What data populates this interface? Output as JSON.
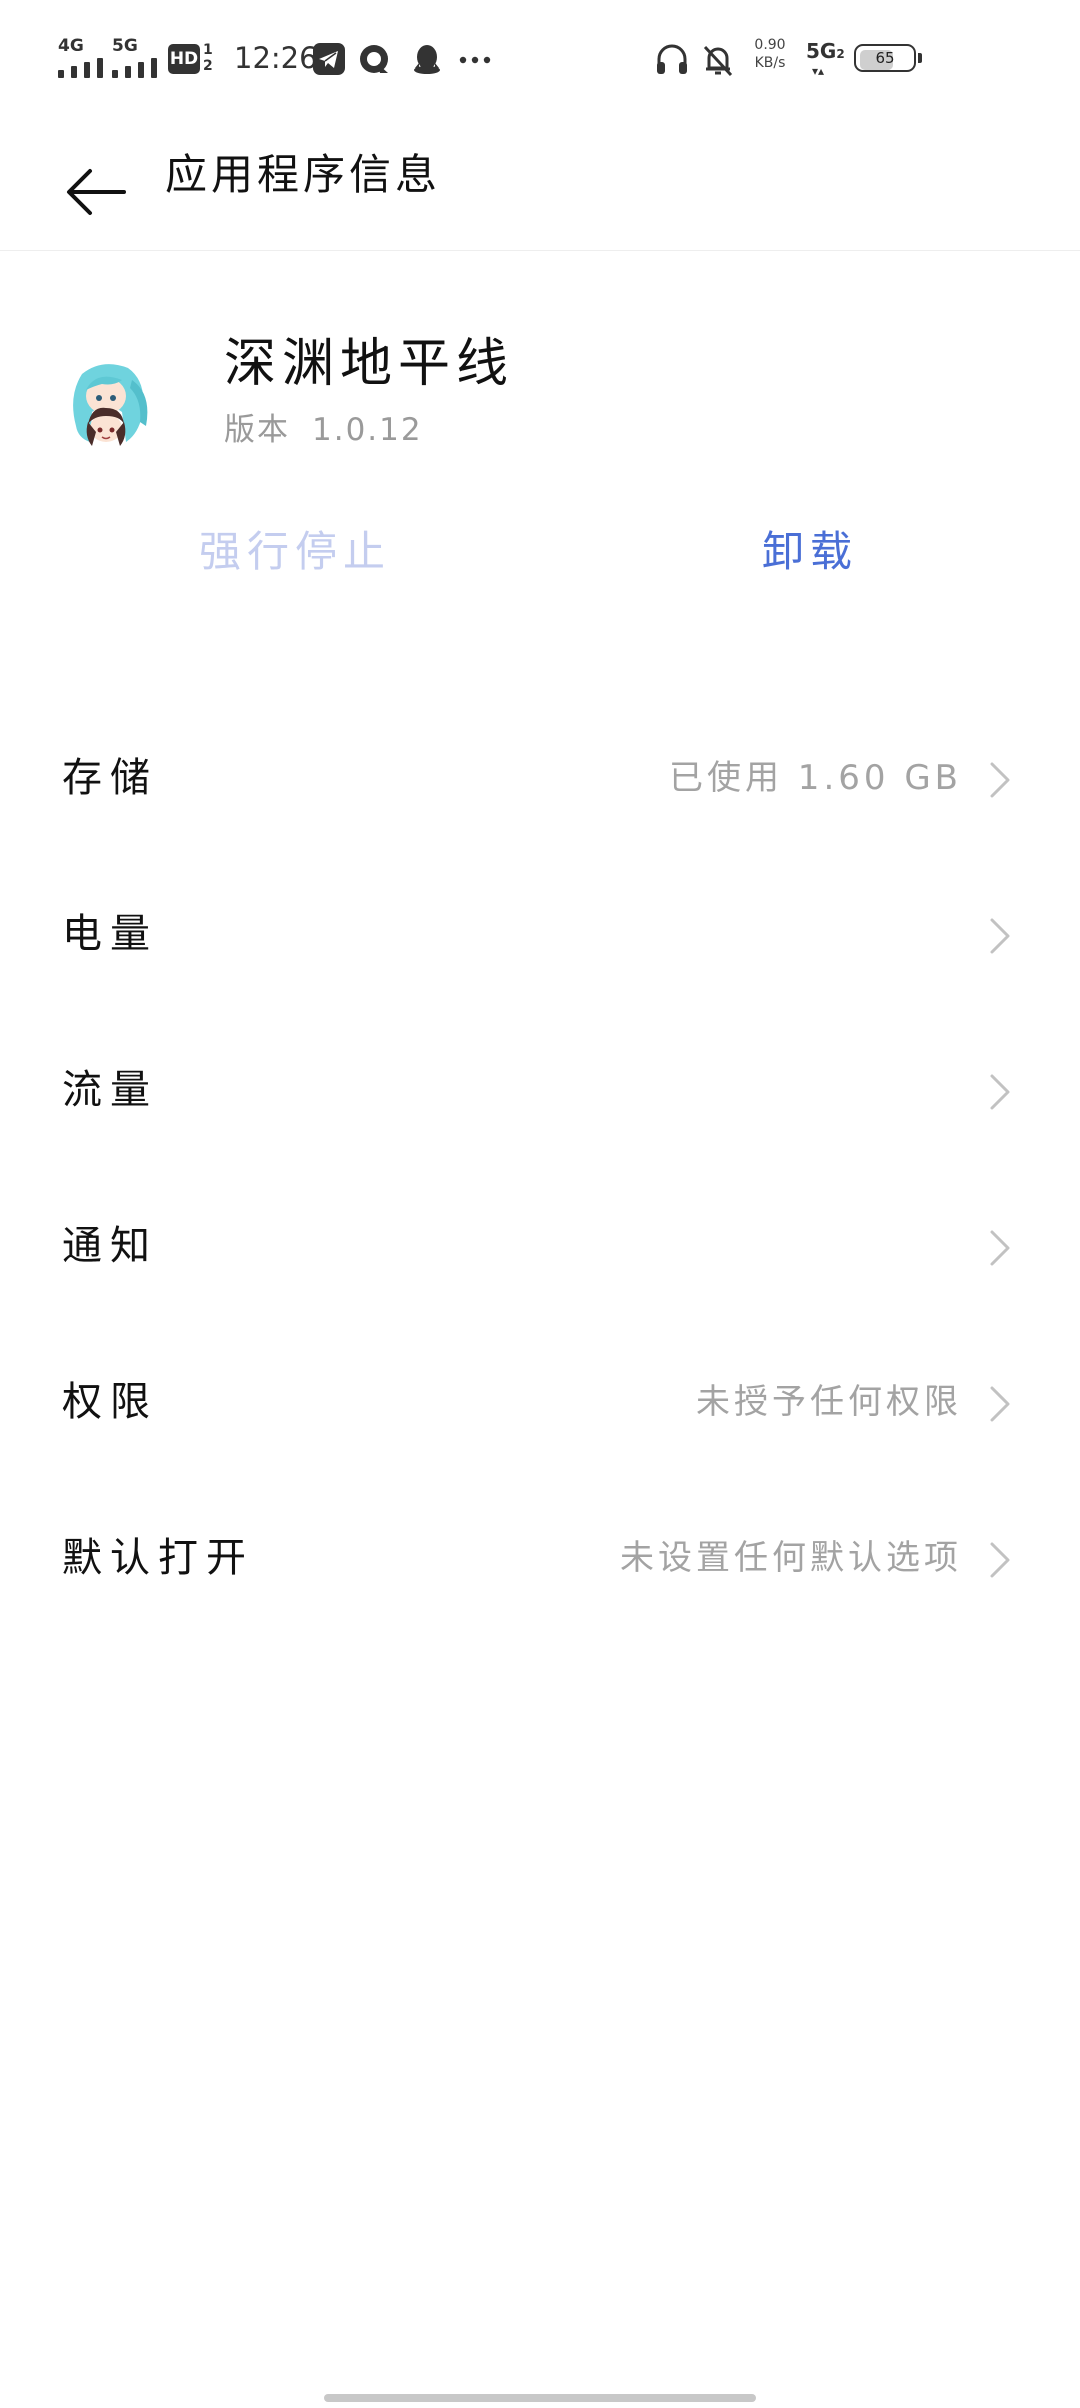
{
  "status_bar": {
    "sim1_network": "4G",
    "sim2_network": "5G",
    "hd_label": "HD",
    "hd_fraction_top": "1",
    "hd_fraction_bottom": "2",
    "time": "12:26",
    "net_speed_value": "0.90",
    "net_speed_unit": "KB/s",
    "data_network": "5G",
    "data_network_sub": "2",
    "battery_level": "65",
    "battery_fraction": 0.65,
    "notification_icons": [
      "telegram-icon",
      "quark-browser-icon",
      "qq-icon",
      "more-dots-icon"
    ],
    "system_icons": [
      "headphones-icon",
      "bell-muted-icon"
    ]
  },
  "app_bar": {
    "title": "应用程序信息"
  },
  "app_header": {
    "name": "深渊地平线",
    "version_label": "版本",
    "version_value": "1.0.12"
  },
  "actions": {
    "force_stop_label": "强行停止",
    "uninstall_label": "卸载"
  },
  "settings": [
    {
      "label": "存储",
      "value": "已使用 1.60 GB"
    },
    {
      "label": "电量",
      "value": ""
    },
    {
      "label": "流量",
      "value": ""
    },
    {
      "label": "通知",
      "value": ""
    },
    {
      "label": "权限",
      "value": "未授予任何权限"
    },
    {
      "label": "默认打开",
      "value": "未设置任何默认选项"
    }
  ],
  "colors": {
    "accent": "#4a6fd6",
    "accent_disabled": "#c4cdef",
    "secondary_text": "#a3a3a3",
    "divider": "#eeeeee"
  }
}
